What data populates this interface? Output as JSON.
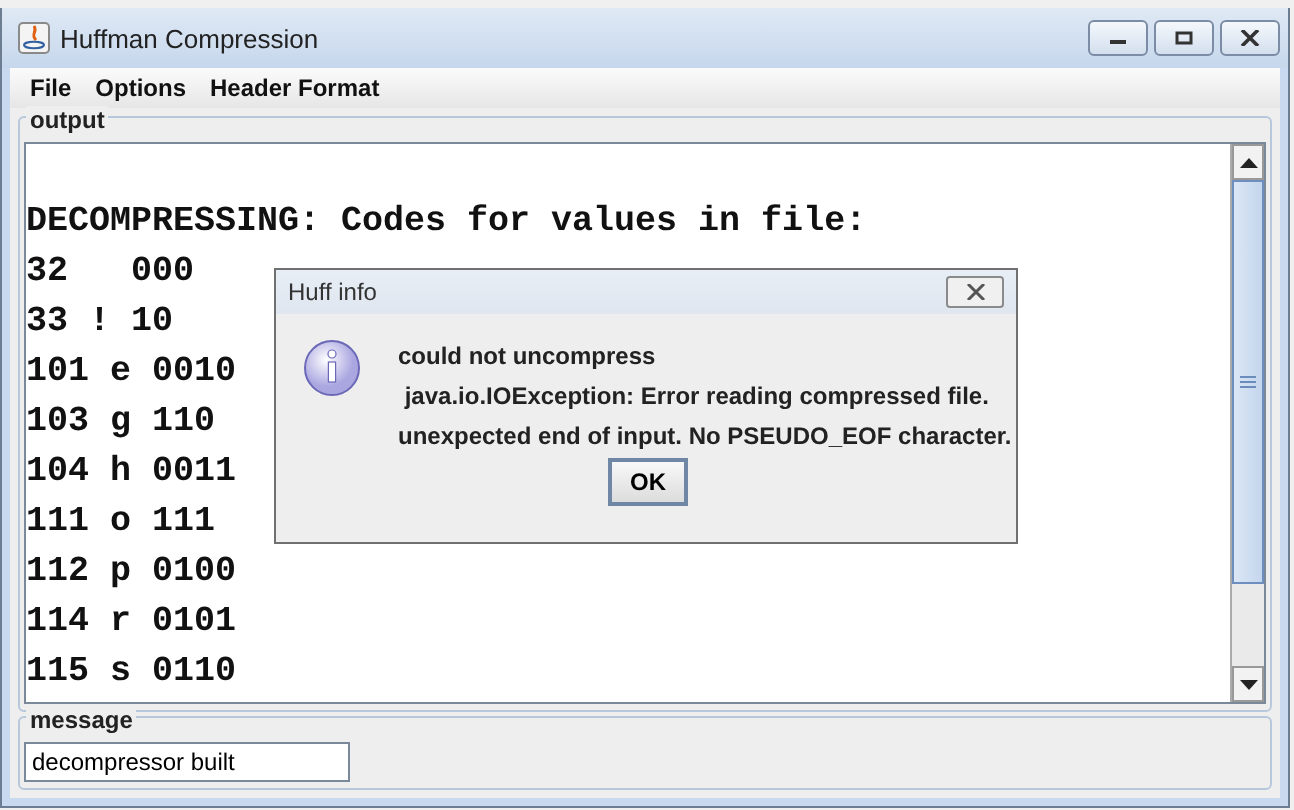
{
  "window": {
    "title": "Huffman Compression"
  },
  "menu": [
    "File",
    "Options",
    "Header Format"
  ],
  "output": {
    "label": "output",
    "lines": [
      "DECOMPRESSING: Codes for values in file:",
      "32   000",
      "33 ! 10",
      "101 e 0010",
      "103 g 110",
      "104 h 0011",
      "111 o 111",
      "112 p 0100",
      "114 r 0101",
      "115 s 0110"
    ]
  },
  "message": {
    "label": "message",
    "value": "decompressor built"
  },
  "dialog": {
    "title": "Huff info",
    "lines": [
      "could not uncompress",
      " java.io.IOException: Error reading compressed file.",
      "unexpected end of input. No PSEUDO_EOF character."
    ],
    "button": "OK"
  }
}
